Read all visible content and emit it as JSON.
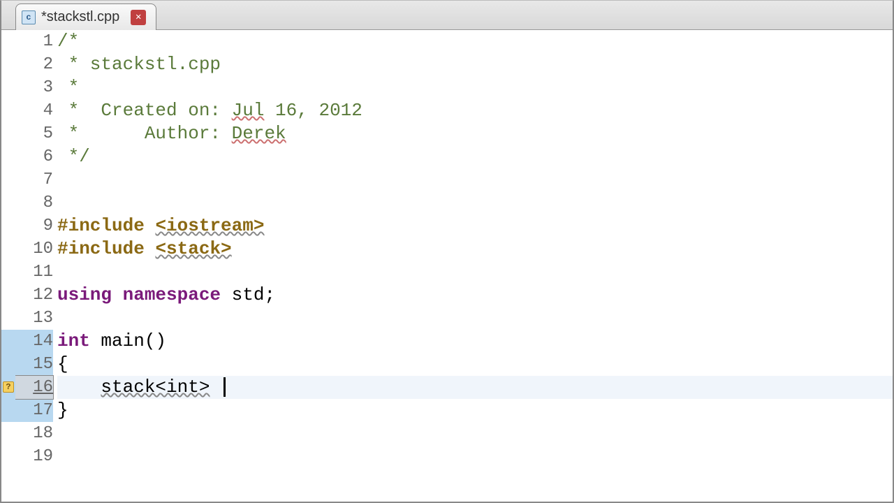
{
  "tab": {
    "title": "*stackstl.cpp",
    "icon_letter": "c"
  },
  "code": {
    "lines": [
      {
        "n": 1,
        "segs": [
          {
            "t": "/*",
            "c": "cm"
          }
        ]
      },
      {
        "n": 2,
        "segs": [
          {
            "t": " * stackstl.cpp",
            "c": "cm"
          }
        ]
      },
      {
        "n": 3,
        "segs": [
          {
            "t": " *",
            "c": "cm"
          }
        ]
      },
      {
        "n": 4,
        "segs": [
          {
            "t": " *  Created on: ",
            "c": "cm"
          },
          {
            "t": "Jul",
            "c": "cm squiggle"
          },
          {
            "t": " 16, 2012",
            "c": "cm"
          }
        ]
      },
      {
        "n": 5,
        "segs": [
          {
            "t": " *      Author: ",
            "c": "cm"
          },
          {
            "t": "Derek",
            "c": "cm squiggle"
          }
        ]
      },
      {
        "n": 6,
        "segs": [
          {
            "t": " */",
            "c": "cm"
          }
        ]
      },
      {
        "n": 7,
        "segs": [
          {
            "t": "",
            "c": ""
          }
        ]
      },
      {
        "n": 8,
        "segs": [
          {
            "t": "",
            "c": ""
          }
        ]
      },
      {
        "n": 9,
        "segs": [
          {
            "t": "#include ",
            "c": "kw-pre"
          },
          {
            "t": "<iostream>",
            "c": "kw-pre squiggleg"
          }
        ]
      },
      {
        "n": 10,
        "segs": [
          {
            "t": "#include ",
            "c": "kw-pre"
          },
          {
            "t": "<stack>",
            "c": "kw-pre squiggleg"
          }
        ]
      },
      {
        "n": 11,
        "segs": [
          {
            "t": "",
            "c": ""
          }
        ]
      },
      {
        "n": 12,
        "segs": [
          {
            "t": "using namespace ",
            "c": "kw"
          },
          {
            "t": "std;",
            "c": ""
          }
        ]
      },
      {
        "n": 13,
        "segs": [
          {
            "t": "",
            "c": ""
          }
        ]
      },
      {
        "n": 14,
        "segs": [
          {
            "t": "int ",
            "c": "kw"
          },
          {
            "t": "main()",
            "c": ""
          }
        ],
        "changed": true
      },
      {
        "n": 15,
        "segs": [
          {
            "t": "{",
            "c": ""
          }
        ],
        "changed": true
      },
      {
        "n": 16,
        "segs": [
          {
            "t": "    ",
            "c": ""
          },
          {
            "t": "stack<int>",
            "c": "squiggleg"
          },
          {
            "t": " ",
            "c": ""
          }
        ],
        "changed": true,
        "current": true,
        "warn": true,
        "cursor": true
      },
      {
        "n": 17,
        "segs": [
          {
            "t": "}",
            "c": ""
          }
        ],
        "changed": true
      },
      {
        "n": 18,
        "segs": [
          {
            "t": "",
            "c": ""
          }
        ]
      },
      {
        "n": 19,
        "segs": [
          {
            "t": "",
            "c": ""
          }
        ]
      }
    ]
  }
}
